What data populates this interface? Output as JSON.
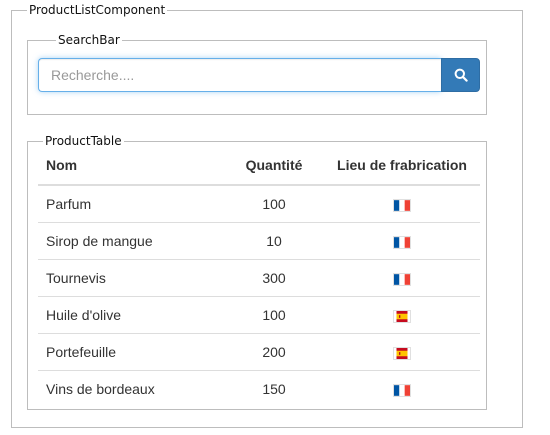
{
  "outer": {
    "legend": "ProductListComponent"
  },
  "search_bar": {
    "legend": "SearchBar",
    "placeholder": "Recherche....",
    "value": "",
    "button_icon": "search-icon"
  },
  "product_table": {
    "legend": "ProductTable",
    "headers": [
      "Nom",
      "Quantité",
      "Lieu de frabrication"
    ],
    "rows": [
      {
        "name": "Parfum",
        "quantity": "100",
        "flag": "france-flag-icon"
      },
      {
        "name": "Sirop de mangue",
        "quantity": "10",
        "flag": "france-flag-icon"
      },
      {
        "name": "Tournevis",
        "quantity": "300",
        "flag": "france-flag-icon"
      },
      {
        "name": "Huile d'olive",
        "quantity": "100",
        "flag": "spain-flag-icon"
      },
      {
        "name": "Portefeuille",
        "quantity": "200",
        "flag": "spain-flag-icon"
      },
      {
        "name": "Vins de bordeaux",
        "quantity": "150",
        "flag": "france-flag-icon"
      }
    ]
  },
  "colors": {
    "button": "#337ab7",
    "focus_border": "#66afe9",
    "group_border": "#bdbdbd",
    "row_border": "#dddddd"
  }
}
